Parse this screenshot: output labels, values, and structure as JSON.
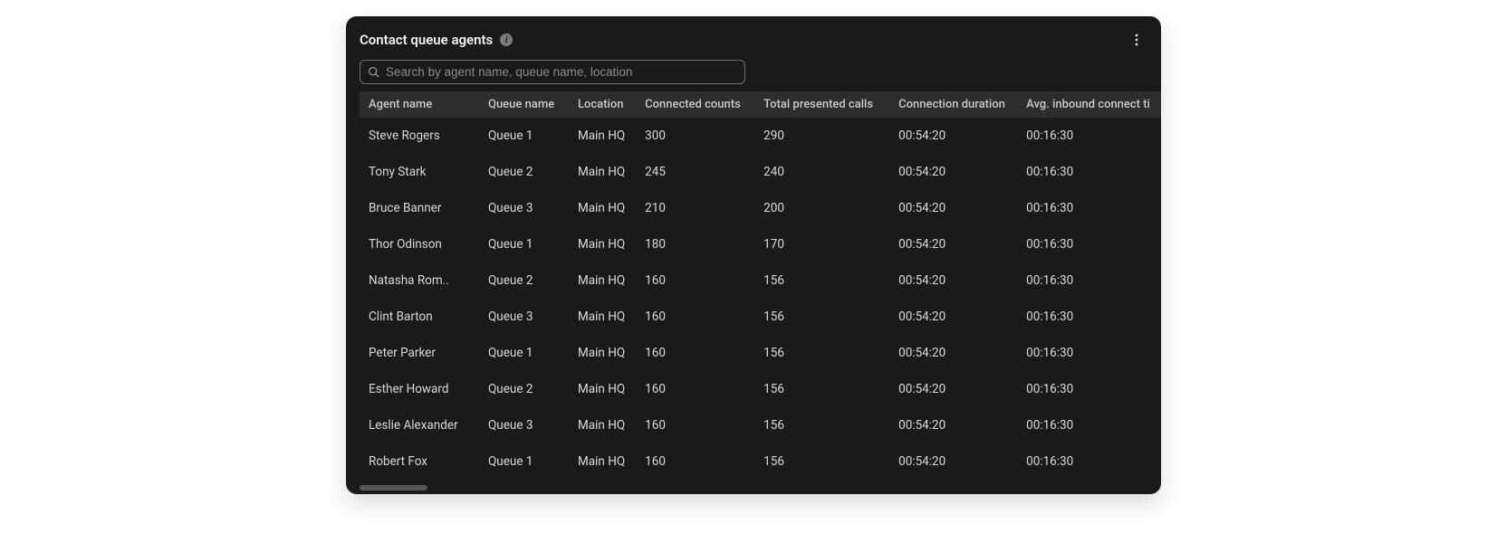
{
  "header": {
    "title": "Contact queue agents",
    "info_glyph": "i"
  },
  "search": {
    "placeholder": "Search by agent name, queue name, location",
    "value": ""
  },
  "columns": {
    "agent": "Agent name",
    "queue": "Queue name",
    "loc": "Location",
    "conn": "Connected counts",
    "total": "Total presented calls",
    "dur": "Connection duration",
    "avg": "Avg. inbound connect ti"
  },
  "rows": [
    {
      "agent": "Steve Rogers",
      "queue": "Queue 1",
      "loc": "Main HQ",
      "conn": "300",
      "total": "290",
      "dur": "00:54:20",
      "avg": "00:16:30"
    },
    {
      "agent": "Tony Stark",
      "queue": "Queue 2",
      "loc": "Main HQ",
      "conn": "245",
      "total": "240",
      "dur": "00:54:20",
      "avg": "00:16:30"
    },
    {
      "agent": "Bruce Banner",
      "queue": "Queue 3",
      "loc": "Main HQ",
      "conn": "210",
      "total": "200",
      "dur": "00:54:20",
      "avg": "00:16:30"
    },
    {
      "agent": "Thor Odinson",
      "queue": "Queue 1",
      "loc": "Main HQ",
      "conn": "180",
      "total": "170",
      "dur": "00:54:20",
      "avg": "00:16:30"
    },
    {
      "agent": "Natasha Rom..",
      "queue": "Queue 2",
      "loc": "Main HQ",
      "conn": "160",
      "total": "156",
      "dur": "00:54:20",
      "avg": "00:16:30"
    },
    {
      "agent": "Clint Barton",
      "queue": "Queue 3",
      "loc": "Main HQ",
      "conn": "160",
      "total": "156",
      "dur": "00:54:20",
      "avg": "00:16:30"
    },
    {
      "agent": "Peter Parker",
      "queue": "Queue 1",
      "loc": "Main HQ",
      "conn": "160",
      "total": "156",
      "dur": "00:54:20",
      "avg": "00:16:30"
    },
    {
      "agent": "Esther Howard",
      "queue": "Queue 2",
      "loc": "Main HQ",
      "conn": "160",
      "total": "156",
      "dur": "00:54:20",
      "avg": "00:16:30"
    },
    {
      "agent": "Leslie Alexander",
      "queue": "Queue 3",
      "loc": "Main HQ",
      "conn": "160",
      "total": "156",
      "dur": "00:54:20",
      "avg": "00:16:30"
    },
    {
      "agent": "Robert Fox",
      "queue": "Queue 1",
      "loc": "Main HQ",
      "conn": "160",
      "total": "156",
      "dur": "00:54:20",
      "avg": "00:16:30"
    }
  ]
}
